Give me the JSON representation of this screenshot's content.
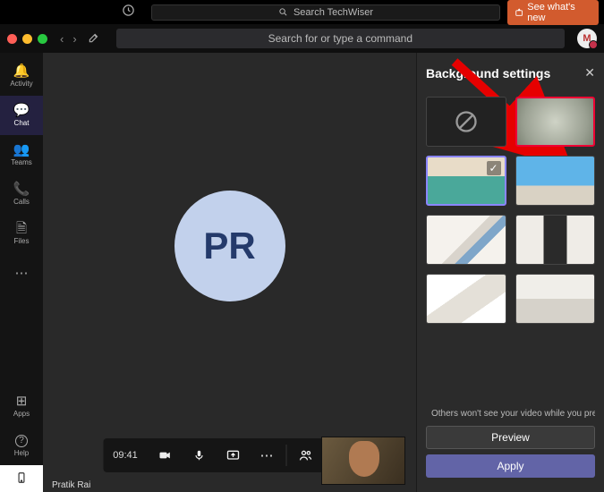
{
  "topbar1": {
    "search_placeholder": "Search TechWiser",
    "whatsnew": "See what's new"
  },
  "topbar2": {
    "command_placeholder": "Search for or type a command",
    "avatar_initial": "M"
  },
  "rail": {
    "items": [
      {
        "id": "activity",
        "label": "Activity",
        "glyph": "🔔"
      },
      {
        "id": "chat",
        "label": "Chat",
        "glyph": "💬",
        "active": true
      },
      {
        "id": "teams",
        "label": "Teams",
        "glyph": "👥"
      },
      {
        "id": "calls",
        "label": "Calls",
        "glyph": "📞"
      },
      {
        "id": "files",
        "label": "Files",
        "glyph": "🗎"
      },
      {
        "id": "more",
        "label": "",
        "glyph": "⋯"
      }
    ],
    "bottom": [
      {
        "id": "apps",
        "label": "Apps",
        "glyph": "⊞"
      },
      {
        "id": "help",
        "label": "Help",
        "glyph": "?"
      },
      {
        "id": "device",
        "label": "",
        "glyph": "▭"
      }
    ]
  },
  "meeting": {
    "avatar_initials": "PR",
    "participant_name": "Pratik Rai",
    "controls": {
      "time": "09:41"
    }
  },
  "panel": {
    "title": "Background settings",
    "info_text": "Others won't see your video while you previe…",
    "preview_label": "Preview",
    "apply_label": "Apply"
  }
}
